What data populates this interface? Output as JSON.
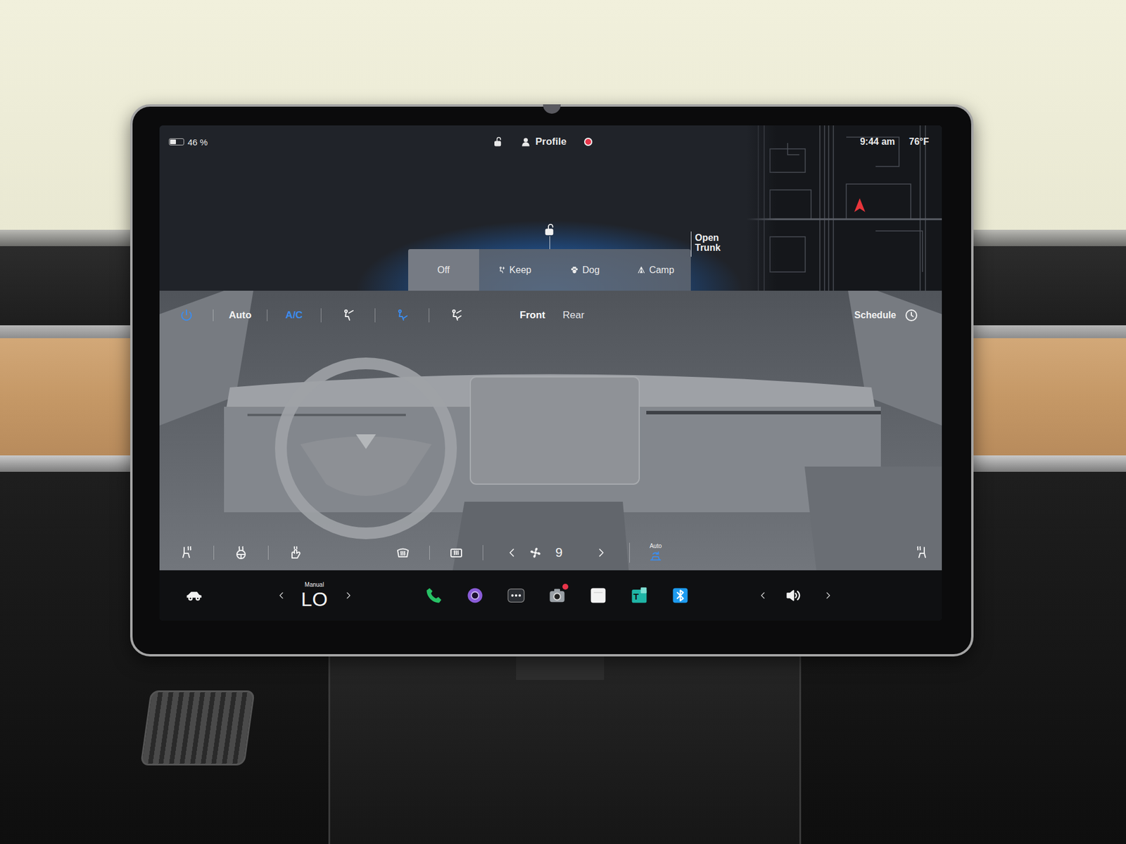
{
  "status_bar": {
    "battery": {
      "text": "46 %",
      "level": 0.46
    },
    "locked": false,
    "profile": "Profile",
    "recording": true,
    "time": "9:44 am",
    "temperature": "76°F"
  },
  "vehicle": {
    "locked": false,
    "open_trunk": "Open Trunk"
  },
  "climate_modes": [
    {
      "label": "Off",
      "selected": true,
      "kind": "off"
    },
    {
      "label": "Keep",
      "selected": false,
      "kind": "keep"
    },
    {
      "label": "Dog",
      "selected": false,
      "kind": "dog"
    },
    {
      "label": "Camp",
      "selected": false,
      "kind": "camp"
    }
  ],
  "climate_toolbar": {
    "power_on": true,
    "auto": {
      "label": "Auto",
      "on": false
    },
    "ac": {
      "label": "A/C",
      "on": true
    },
    "airflow": [
      {
        "selected": false
      },
      {
        "selected": true
      },
      {
        "selected": false
      }
    ],
    "zones": [
      {
        "label": "Front",
        "selected": true
      },
      {
        "label": "Rear",
        "selected": false
      }
    ],
    "schedule": "Schedule"
  },
  "climate_controls": {
    "fan_speed": "9",
    "recirculation": {
      "label": "Auto",
      "on": true
    }
  },
  "taskbar": {
    "temperature": {
      "mode": "Manual",
      "value": "LO"
    },
    "apps": [
      {
        "kind": "phone",
        "color": "#27c165",
        "badge": false
      },
      {
        "kind": "camera",
        "color": "#8a5cd8",
        "badge": false
      },
      {
        "kind": "more",
        "color": "#2b2e33",
        "badge": false
      },
      {
        "kind": "dashcam",
        "color": "#9aa0a6",
        "badge": true
      },
      {
        "kind": "notes",
        "color": "#f2f2f2",
        "badge": false
      },
      {
        "kind": "toybox",
        "color": "#1fb5a6",
        "badge": false,
        "label": "T"
      },
      {
        "kind": "bluetooth",
        "color": "#1d9bf0",
        "badge": false
      }
    ]
  }
}
